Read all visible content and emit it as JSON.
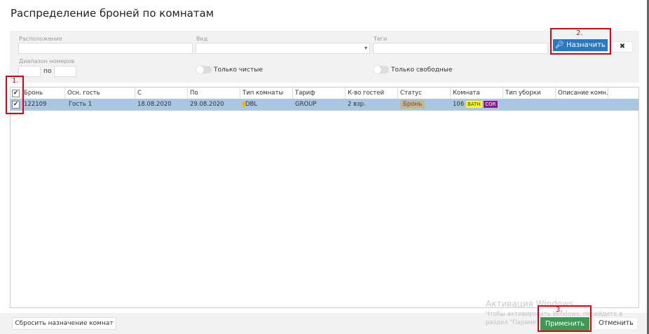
{
  "title": "Распределение броней по комнатам",
  "filters": {
    "location_label": "Расположение",
    "location_value": "",
    "view_label": "Вид",
    "view_value": "",
    "tags_label": "Теги",
    "tags_value": "",
    "range_label": "Диапазон номеров",
    "range_from": "",
    "range_sep": "по",
    "range_to": "",
    "only_clean": "Только чистые",
    "only_free": "Только свободные",
    "only_clean_on": false,
    "only_free_on": false
  },
  "assign_button": "Назначить",
  "clear_button": "✖",
  "annotations": [
    "1.",
    "2.",
    "3."
  ],
  "table": {
    "headers": [
      "Бронь",
      "Осн. гость",
      "С",
      "По",
      "Тип комнаты",
      "Тариф",
      "К-во гостей",
      "Статус",
      "Комната",
      "Тип уборки",
      "Описание комн..."
    ],
    "rows": [
      {
        "checked": true,
        "booking": "122109",
        "guest": "Гость 1",
        "from": "18.08.2020",
        "to": "29.08.2020",
        "room_type": "DBL",
        "tariff": "GROUP",
        "guests": "2 взр.",
        "status": "Бронь",
        "room": "106",
        "room_tags": [
          "BATH",
          "COR"
        ],
        "cleaning": "",
        "description": ""
      }
    ]
  },
  "footer": {
    "reset": "Сбросить назначение комнат",
    "apply": "Применить",
    "cancel": "Отменить"
  },
  "watermark": {
    "line1": "Активация Windows",
    "line2": "Чтобы активировать Windows, перейдите в раздел \"Параметры\"."
  },
  "colors": {
    "assign": "#2c78bf",
    "apply": "#3c9a55",
    "selected_row": "#a9c6e3",
    "annotation": "#e00010"
  }
}
